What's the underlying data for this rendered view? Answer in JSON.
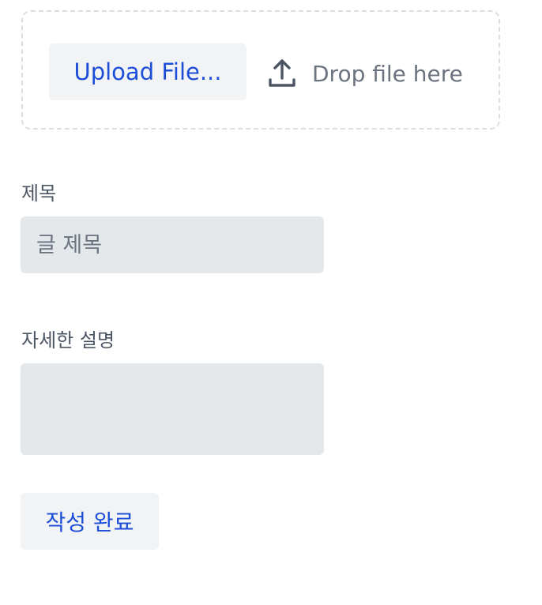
{
  "upload": {
    "button_label": "Upload File...",
    "drop_hint": "Drop file here",
    "icon": "upload-icon"
  },
  "form": {
    "title_label": "제목",
    "title_placeholder": "글 제목",
    "title_value": "",
    "description_label": "자세한 설명",
    "description_value": "",
    "submit_label": "작성 완료"
  },
  "colors": {
    "accent": "#1d4ed8",
    "button_bg": "#f2f3f5",
    "input_bg": "#e5e8eb",
    "muted_text": "#6b7280",
    "dashed_border": "#dcdde1"
  }
}
